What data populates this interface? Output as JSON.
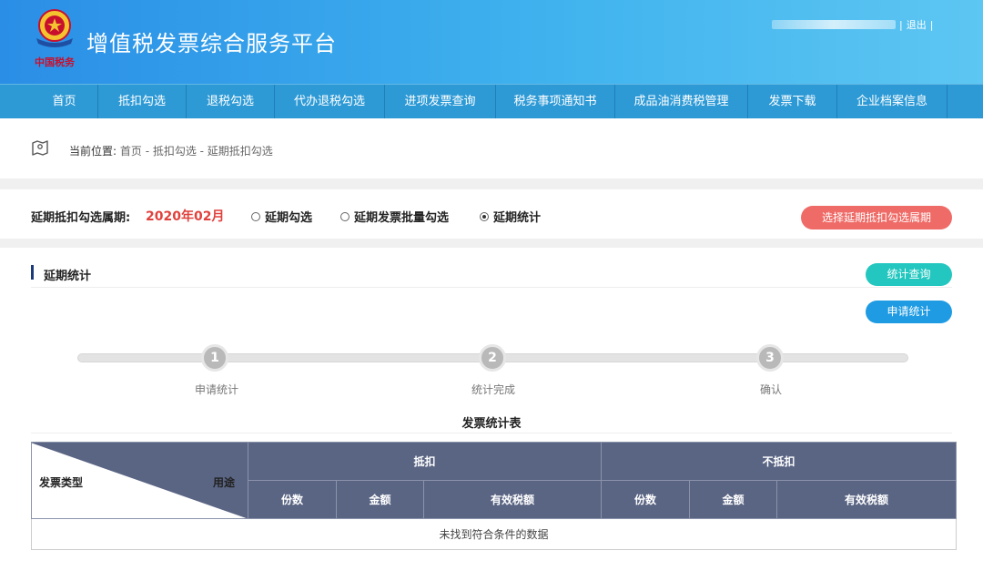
{
  "header": {
    "title": "增值税发票综合服务平台",
    "logo_text": "中国税务",
    "user_separator": "|",
    "logout": "退出"
  },
  "nav": {
    "items": [
      {
        "label": "首页"
      },
      {
        "label": "抵扣勾选"
      },
      {
        "label": "退税勾选"
      },
      {
        "label": "代办退税勾选"
      },
      {
        "label": "进项发票查询"
      },
      {
        "label": "税务事项通知书"
      },
      {
        "label": "成品油消费税管理"
      },
      {
        "label": "发票下载"
      },
      {
        "label": "企业档案信息"
      }
    ]
  },
  "breadcrumb": {
    "prefix": "当前位置:",
    "path": "首页 - 抵扣勾选 - 延期抵扣勾选"
  },
  "period": {
    "label": "延期抵扣勾选属期:",
    "value": "2020年02月",
    "options": [
      {
        "label": "延期勾选",
        "selected": false
      },
      {
        "label": "延期发票批量勾选",
        "selected": false
      },
      {
        "label": "延期统计",
        "selected": true
      }
    ],
    "select_button": "选择延期抵扣勾选属期"
  },
  "section": {
    "title": "延期统计",
    "stat_query_button": "统计查询",
    "apply_stat_button": "申请统计"
  },
  "steps": [
    {
      "number": "1",
      "label": "申请统计"
    },
    {
      "number": "2",
      "label": "统计完成"
    },
    {
      "number": "3",
      "label": "确认"
    }
  ],
  "table": {
    "title": "发票统计表",
    "corner_left": "发票类型",
    "corner_right": "用途",
    "group_deduct": "抵扣",
    "group_no_deduct": "不抵扣",
    "columns": [
      "份数",
      "金额",
      "有效税额",
      "份数",
      "金额",
      "有效税额"
    ],
    "empty_text": "未找到符合条件的数据"
  },
  "colors": {
    "header_gradient_start": "#2a8ee6",
    "nav_bg": "#2d9ad6",
    "accent_red": "#e0413d",
    "btn_red": "#ef6b67",
    "btn_teal": "#23c7bf",
    "btn_blue": "#1e9be2",
    "table_header": "#5a6584"
  }
}
